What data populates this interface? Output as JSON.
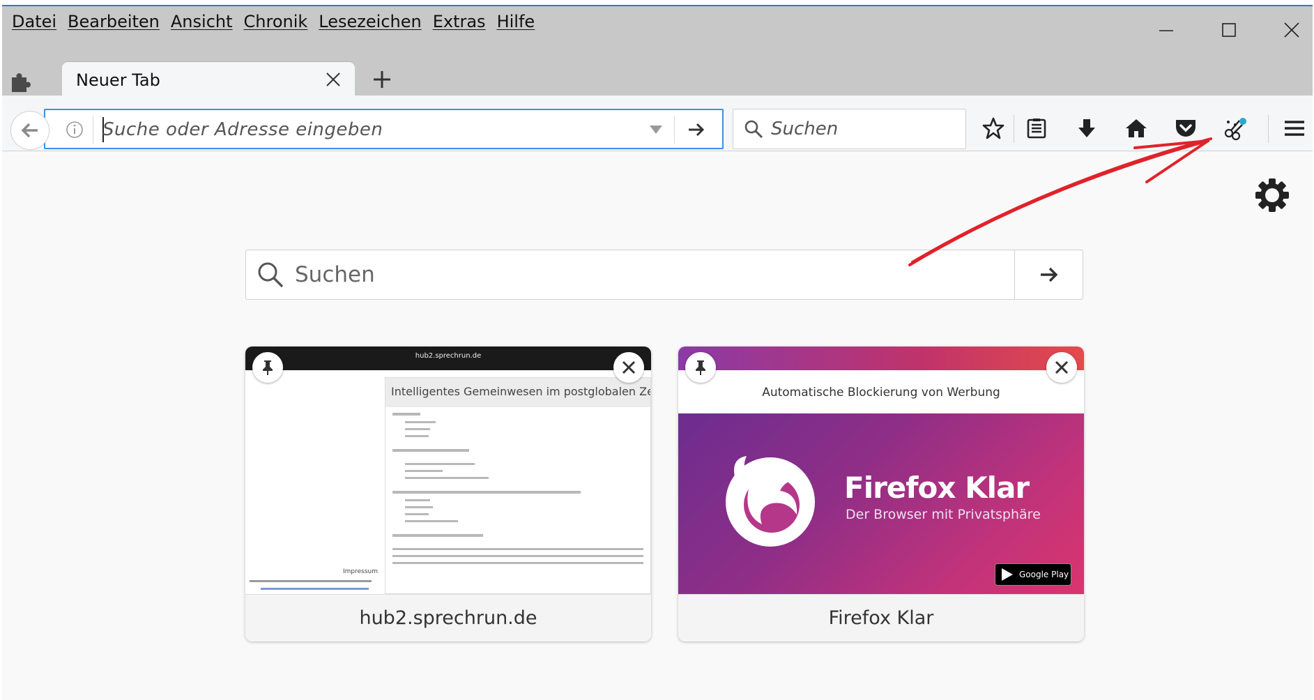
{
  "menu": [
    "Datei",
    "Bearbeiten",
    "Ansicht",
    "Chronik",
    "Lesezeichen",
    "Extras",
    "Hilfe"
  ],
  "tab": {
    "title": "Neuer Tab"
  },
  "urlbar": {
    "placeholder": "Suche oder Adresse eingeben"
  },
  "searchbar": {
    "placeholder": "Suchen"
  },
  "toolbar_icons": [
    "bookmark-star-icon",
    "reader-list-icon",
    "download-icon",
    "home-icon",
    "pocket-icon",
    "extension-icon",
    "hamburger-menu-icon"
  ],
  "page_search": {
    "placeholder": "Suchen"
  },
  "tiles": [
    {
      "caption": "hub2.sprechrun.de",
      "thumb_header": "hub2.sprechrun.de",
      "thumb_title": "Intelligentes Gemeinwesen im postglobalen Zeitalter",
      "thumb_impressum": "Impressum"
    },
    {
      "caption": "Firefox Klar",
      "thumb_toptext": "Automatische Blockierung von Werbung",
      "thumb_brand": "Firefox Klar",
      "thumb_tagline": "Der Browser mit Privatsphäre",
      "thumb_store": "Google Play"
    }
  ],
  "colors": {
    "accent": "#3d8fe0",
    "annotation": "#e0222a"
  }
}
